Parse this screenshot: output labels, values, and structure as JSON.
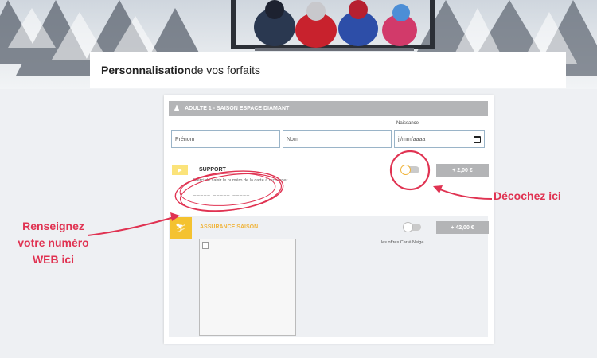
{
  "header": {
    "title_bold": "Personnalisation",
    "title_rest": " de vos forfaits"
  },
  "product": {
    "bar_label": "ADULTE 1 - SAISON ESPACE DIAMANT"
  },
  "form": {
    "naissance_label": "Naissance",
    "prenom_placeholder": "Prénom",
    "nom_placeholder": "Nom",
    "date_placeholder": "jj/mm/aaaa"
  },
  "support": {
    "title": "SUPPORT",
    "help_text": "Merci de saisir le numéro de la carte à recharger",
    "number_mask": "_____-_____-_____",
    "price": "+ 2,00 €",
    "toggle_on": false
  },
  "insurance": {
    "title": "ASSURANCE SAISON",
    "offers_text": "les offres Carré Neige.",
    "price": "+ 42,00 €",
    "toggle_on": false
  },
  "annotations": {
    "left_line1": "Renseignez",
    "left_line2": "votre numéro",
    "left_line3": "WEB ici",
    "right": "Décochez ici"
  },
  "colors": {
    "accent": "#e03352",
    "support_yellow": "#fbe37a",
    "insurance_yellow": "#f4c230",
    "bar_grey": "#b4b5b7"
  },
  "icons": {
    "person": "person-icon",
    "ticket": "ticket-icon",
    "shield": "skier-shield-icon",
    "calendar": "calendar-icon"
  }
}
